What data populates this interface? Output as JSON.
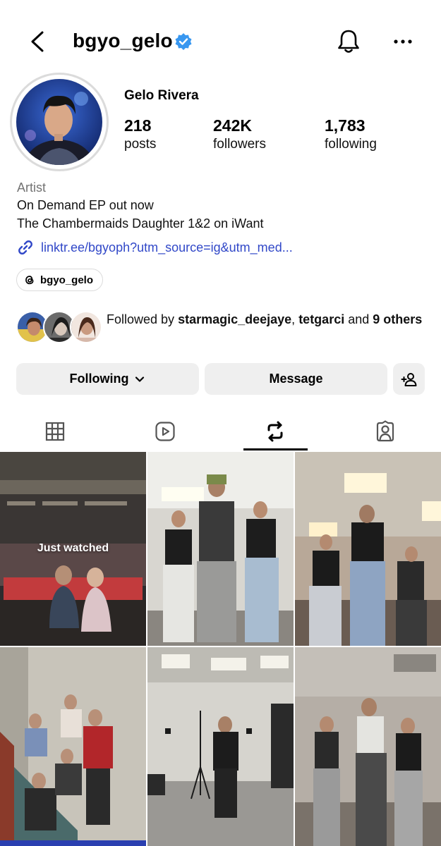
{
  "header": {
    "username": "bgyo_gelo",
    "icons": [
      "back-icon",
      "verified-badge-icon",
      "bell-icon",
      "more-options-icon"
    ]
  },
  "profile": {
    "display_name": "Gelo Rivera",
    "stats": {
      "posts": {
        "value": "218",
        "label": "posts"
      },
      "followers": {
        "value": "242K",
        "label": "followers"
      },
      "following": {
        "value": "1,783",
        "label": "following"
      }
    },
    "category": "Artist",
    "bio_line1": "On Demand EP out now",
    "bio_line2": "The Chambermaids Daughter 1&2 on iWant",
    "link": "linktr.ee/bgyoph?utm_source=ig&utm_med...",
    "threads_handle": "bgyo_gelo"
  },
  "followed_by": {
    "prefix": "Followed by ",
    "user1": "starmagic_deejaye",
    "sep": ", ",
    "user2": "tetgarci",
    "and": " and ",
    "others": "9 others"
  },
  "actions": {
    "following_label": "Following",
    "message_label": "Message"
  },
  "tabs": [
    {
      "name": "posts-grid",
      "icon": "grid-icon",
      "selected": false
    },
    {
      "name": "reels",
      "icon": "reels-icon",
      "selected": false
    },
    {
      "name": "reposts",
      "icon": "repost-icon",
      "selected": true
    },
    {
      "name": "tagged",
      "icon": "tagged-user-icon",
      "selected": false
    }
  ],
  "grid": {
    "first_overlay": "Just watched"
  },
  "colors": {
    "verified": "#3897f0",
    "link": "#3148c8",
    "button_bg": "#efefef",
    "muted": "#737373"
  }
}
